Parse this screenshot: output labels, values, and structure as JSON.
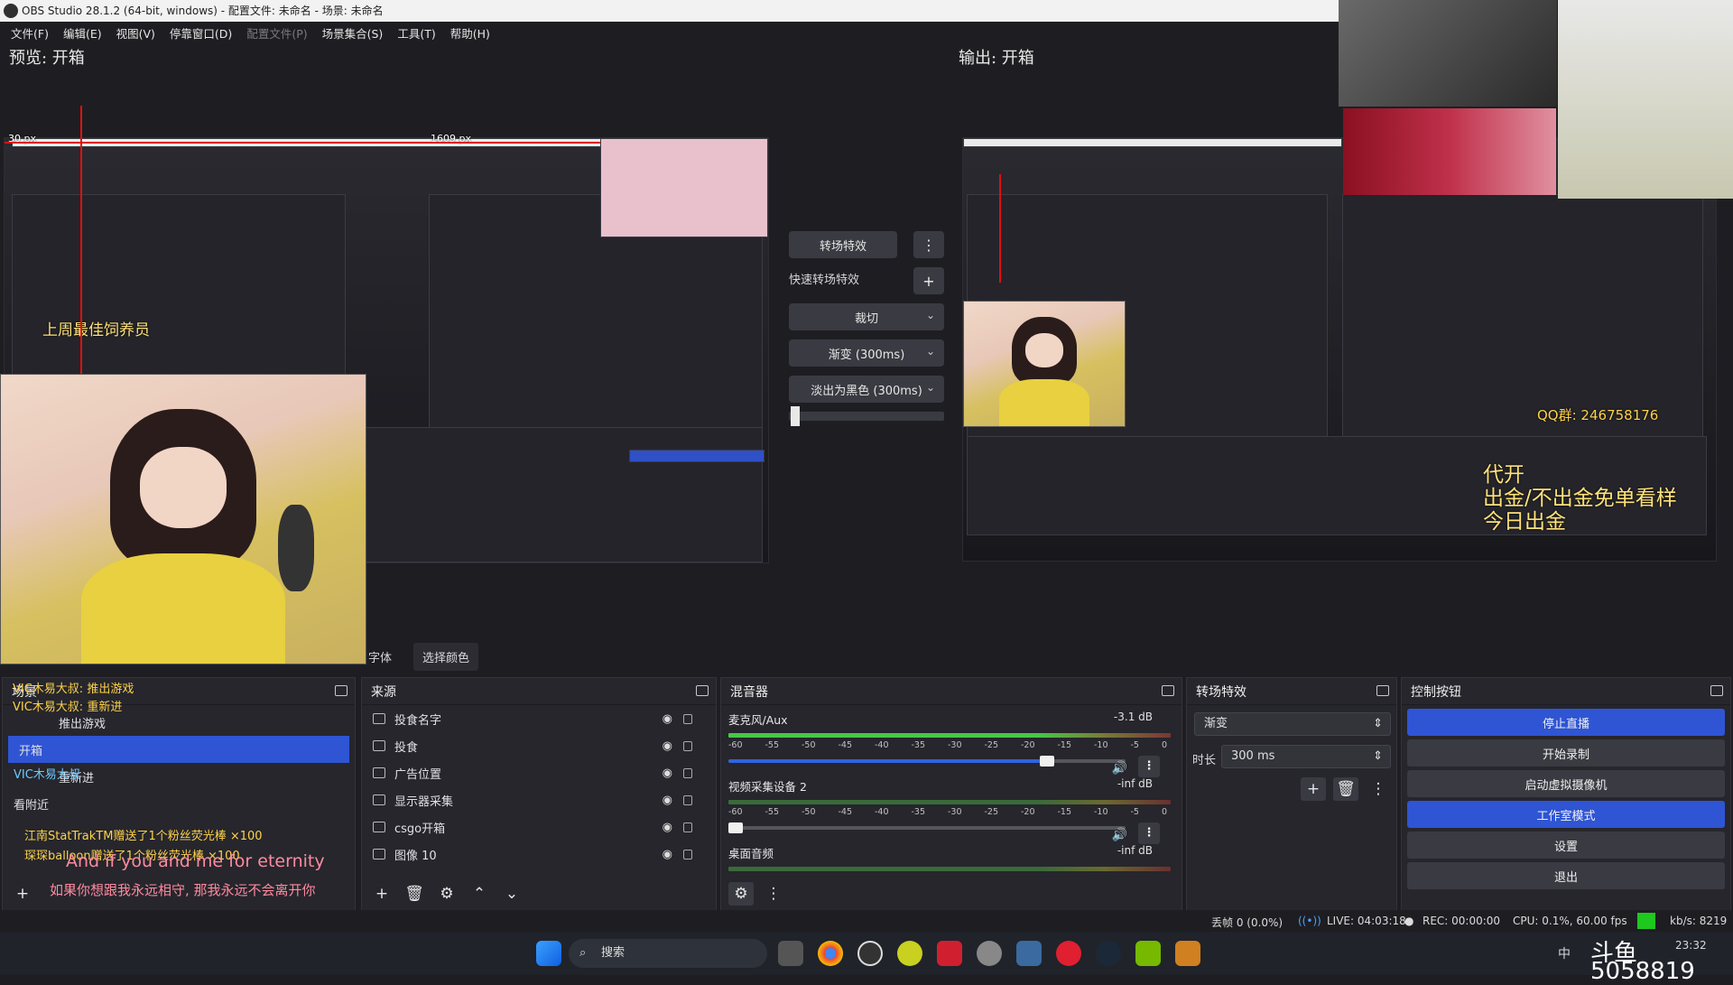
{
  "window": {
    "title": "OBS Studio 28.1.2 (64-bit, windows) - 配置文件: 未命名 - 场景: 未命名"
  },
  "menu": [
    "文件(F)",
    "编辑(E)",
    "视图(V)",
    "停靠窗口(D)",
    "配置文件(P)",
    "场景集合(S)",
    "工具(T)",
    "帮助(H)"
  ],
  "preview": {
    "left_label": "预览: 开箱",
    "right_label": "输出: 开箱",
    "px_labels": [
      "30 px",
      "1609 px"
    ]
  },
  "transition_center": {
    "title_button": "转场特效",
    "quick_label": "快速转场特效",
    "items": [
      "裁切",
      "渐变 (300ms)",
      "淡出为黑色 (300ms)"
    ]
  },
  "filter_buttons": [
    "字体",
    "选择颜色"
  ],
  "scenes": {
    "title": "场景",
    "items": [
      "开箱",
      "推出游戏",
      "重新进",
      "看附近"
    ]
  },
  "sources": {
    "title": "来源",
    "items": [
      {
        "label": "投食名字",
        "icon": "text-icon"
      },
      {
        "label": "投食",
        "icon": "image-icon"
      },
      {
        "label": "广告位置",
        "icon": "image-icon"
      },
      {
        "label": "显示器采集",
        "icon": "monitor-icon"
      },
      {
        "label": "csgo开箱",
        "icon": "game-capture-icon"
      },
      {
        "label": "图像 10",
        "icon": "image-icon"
      }
    ]
  },
  "mixer": {
    "title": "混音器",
    "channels": [
      {
        "name": "麦克风/Aux",
        "db": "-3.1 dB",
        "volume": 0.9
      },
      {
        "name": "视频采集设备 2",
        "db": "-inf dB",
        "volume": 0.02
      },
      {
        "name": "桌面音频",
        "db": "-inf dB",
        "volume": 0.0
      }
    ],
    "ticks": [
      "-60",
      "-55",
      "-50",
      "-45",
      "-40",
      "-35",
      "-30",
      "-25",
      "-20",
      "-15",
      "-10",
      "-5",
      "0"
    ]
  },
  "transitions": {
    "title": "转场特效",
    "selected": "渐变",
    "duration_label": "时长",
    "duration_value": "300 ms"
  },
  "controls": {
    "title": "控制按钮",
    "buttons": [
      "停止直播",
      "开始录制",
      "启动虚拟摄像机",
      "工作室模式",
      "设置",
      "退出"
    ]
  },
  "status": {
    "dropped": "丢帧 0 (0.0%)",
    "live": "LIVE: 04:03:18",
    "rec": "REC: 00:00:00",
    "cpu": "CPU: 0.1%, 60.00 fps",
    "kbs": "kb/s: 8219"
  },
  "chat_overlay": {
    "lines": [
      "VIC木易大叔: 推出游戏",
      "VIC木易大叔: 重新进",
      "VIC木易大叔",
      "VIC木易大叔",
      "江南StatTrakTM赠送了1个粉丝荧光棒 ×100",
      "琛琛balloon赠送了1个粉丝荧光棒 ×100"
    ],
    "lyric1": "And if you and me for eternity",
    "lyric2": "如果你想跟我永远相守, 那我永远不会离开你"
  },
  "stream_overlay": {
    "banner": "上周最佳饲养员",
    "promo_lines": [
      "代开",
      "出金/不出金免单看样",
      "今日出金"
    ],
    "qq": "QQ群: 246758176",
    "watermark": "斗鱼5058819"
  },
  "taskbar": {
    "search_placeholder": "搜索",
    "clock": "23:32",
    "ime": "中"
  },
  "colors": {
    "accent": "#2f55d4",
    "panel": "#26262c",
    "background": "#1e1e22"
  }
}
